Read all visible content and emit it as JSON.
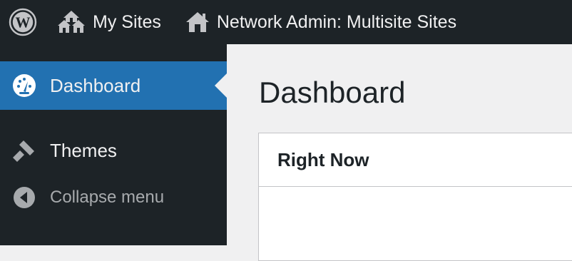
{
  "adminbar": {
    "logo_icon": "wordpress-logo-icon",
    "my_sites": {
      "icon": "multisite-houses-icon",
      "label": "My Sites"
    },
    "network_admin": {
      "icon": "home-icon",
      "label": "Network Admin: Multisite Sites"
    }
  },
  "sidebar": {
    "items": [
      {
        "icon": "dashboard-gauge-icon",
        "label": "Dashboard",
        "active": true
      },
      {
        "icon": "paintbrush-icon",
        "label": "Themes",
        "active": false
      }
    ],
    "collapse": {
      "icon": "collapse-arrow-icon",
      "label": "Collapse menu"
    }
  },
  "main": {
    "title": "Dashboard",
    "widgets": [
      {
        "title": "Right Now"
      }
    ]
  },
  "colors": {
    "adminbar_bg": "#1d2327",
    "sidebar_bg": "#1d2327",
    "active_item_bg": "#2271b1",
    "content_bg": "#f0f0f1",
    "text_light": "#f0f0f1",
    "text_muted": "#a7aaad"
  }
}
